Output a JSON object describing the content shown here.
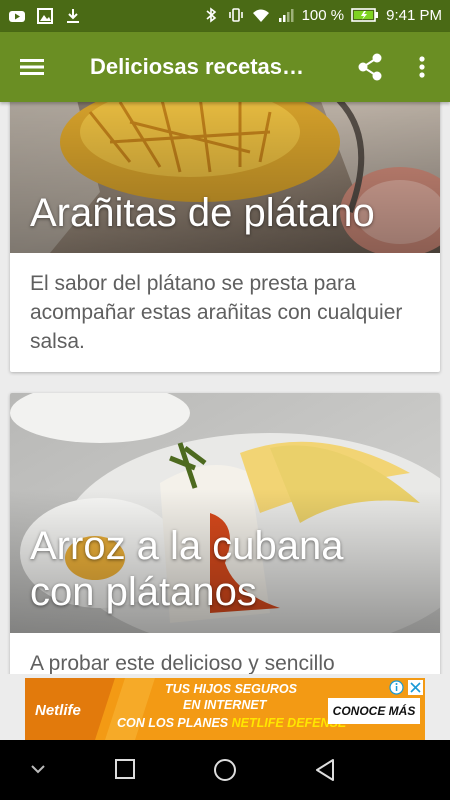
{
  "status_bar": {
    "battery": "100 %",
    "time": "9:41 PM"
  },
  "app_bar": {
    "title": "Deliciosas recetas…"
  },
  "cards": [
    {
      "title": "Arañitas de plátano",
      "description": "El sabor del plátano se presta para acompañar estas arañitas con cualquier salsa."
    },
    {
      "title": "Arroz a la cubana con plátanos",
      "title_line1": "Arroz a la cubana",
      "title_line2": "con plátanos",
      "description": "A probar este delicioso y sencillo"
    }
  ],
  "ad": {
    "brand": "Netlife",
    "line1": "TUS HIJOS SEGUROS",
    "line2": "EN INTERNET",
    "line3_a": "CON LOS PLANES",
    "line3_b": "NETLIFE DEFENSE",
    "cta": "CONOCE MÁS"
  },
  "colors": {
    "status_bar": "#4a6a15",
    "app_bar": "#6a8e23",
    "ad_orange": "#f39a14",
    "ad_yellow": "#ffe600"
  }
}
